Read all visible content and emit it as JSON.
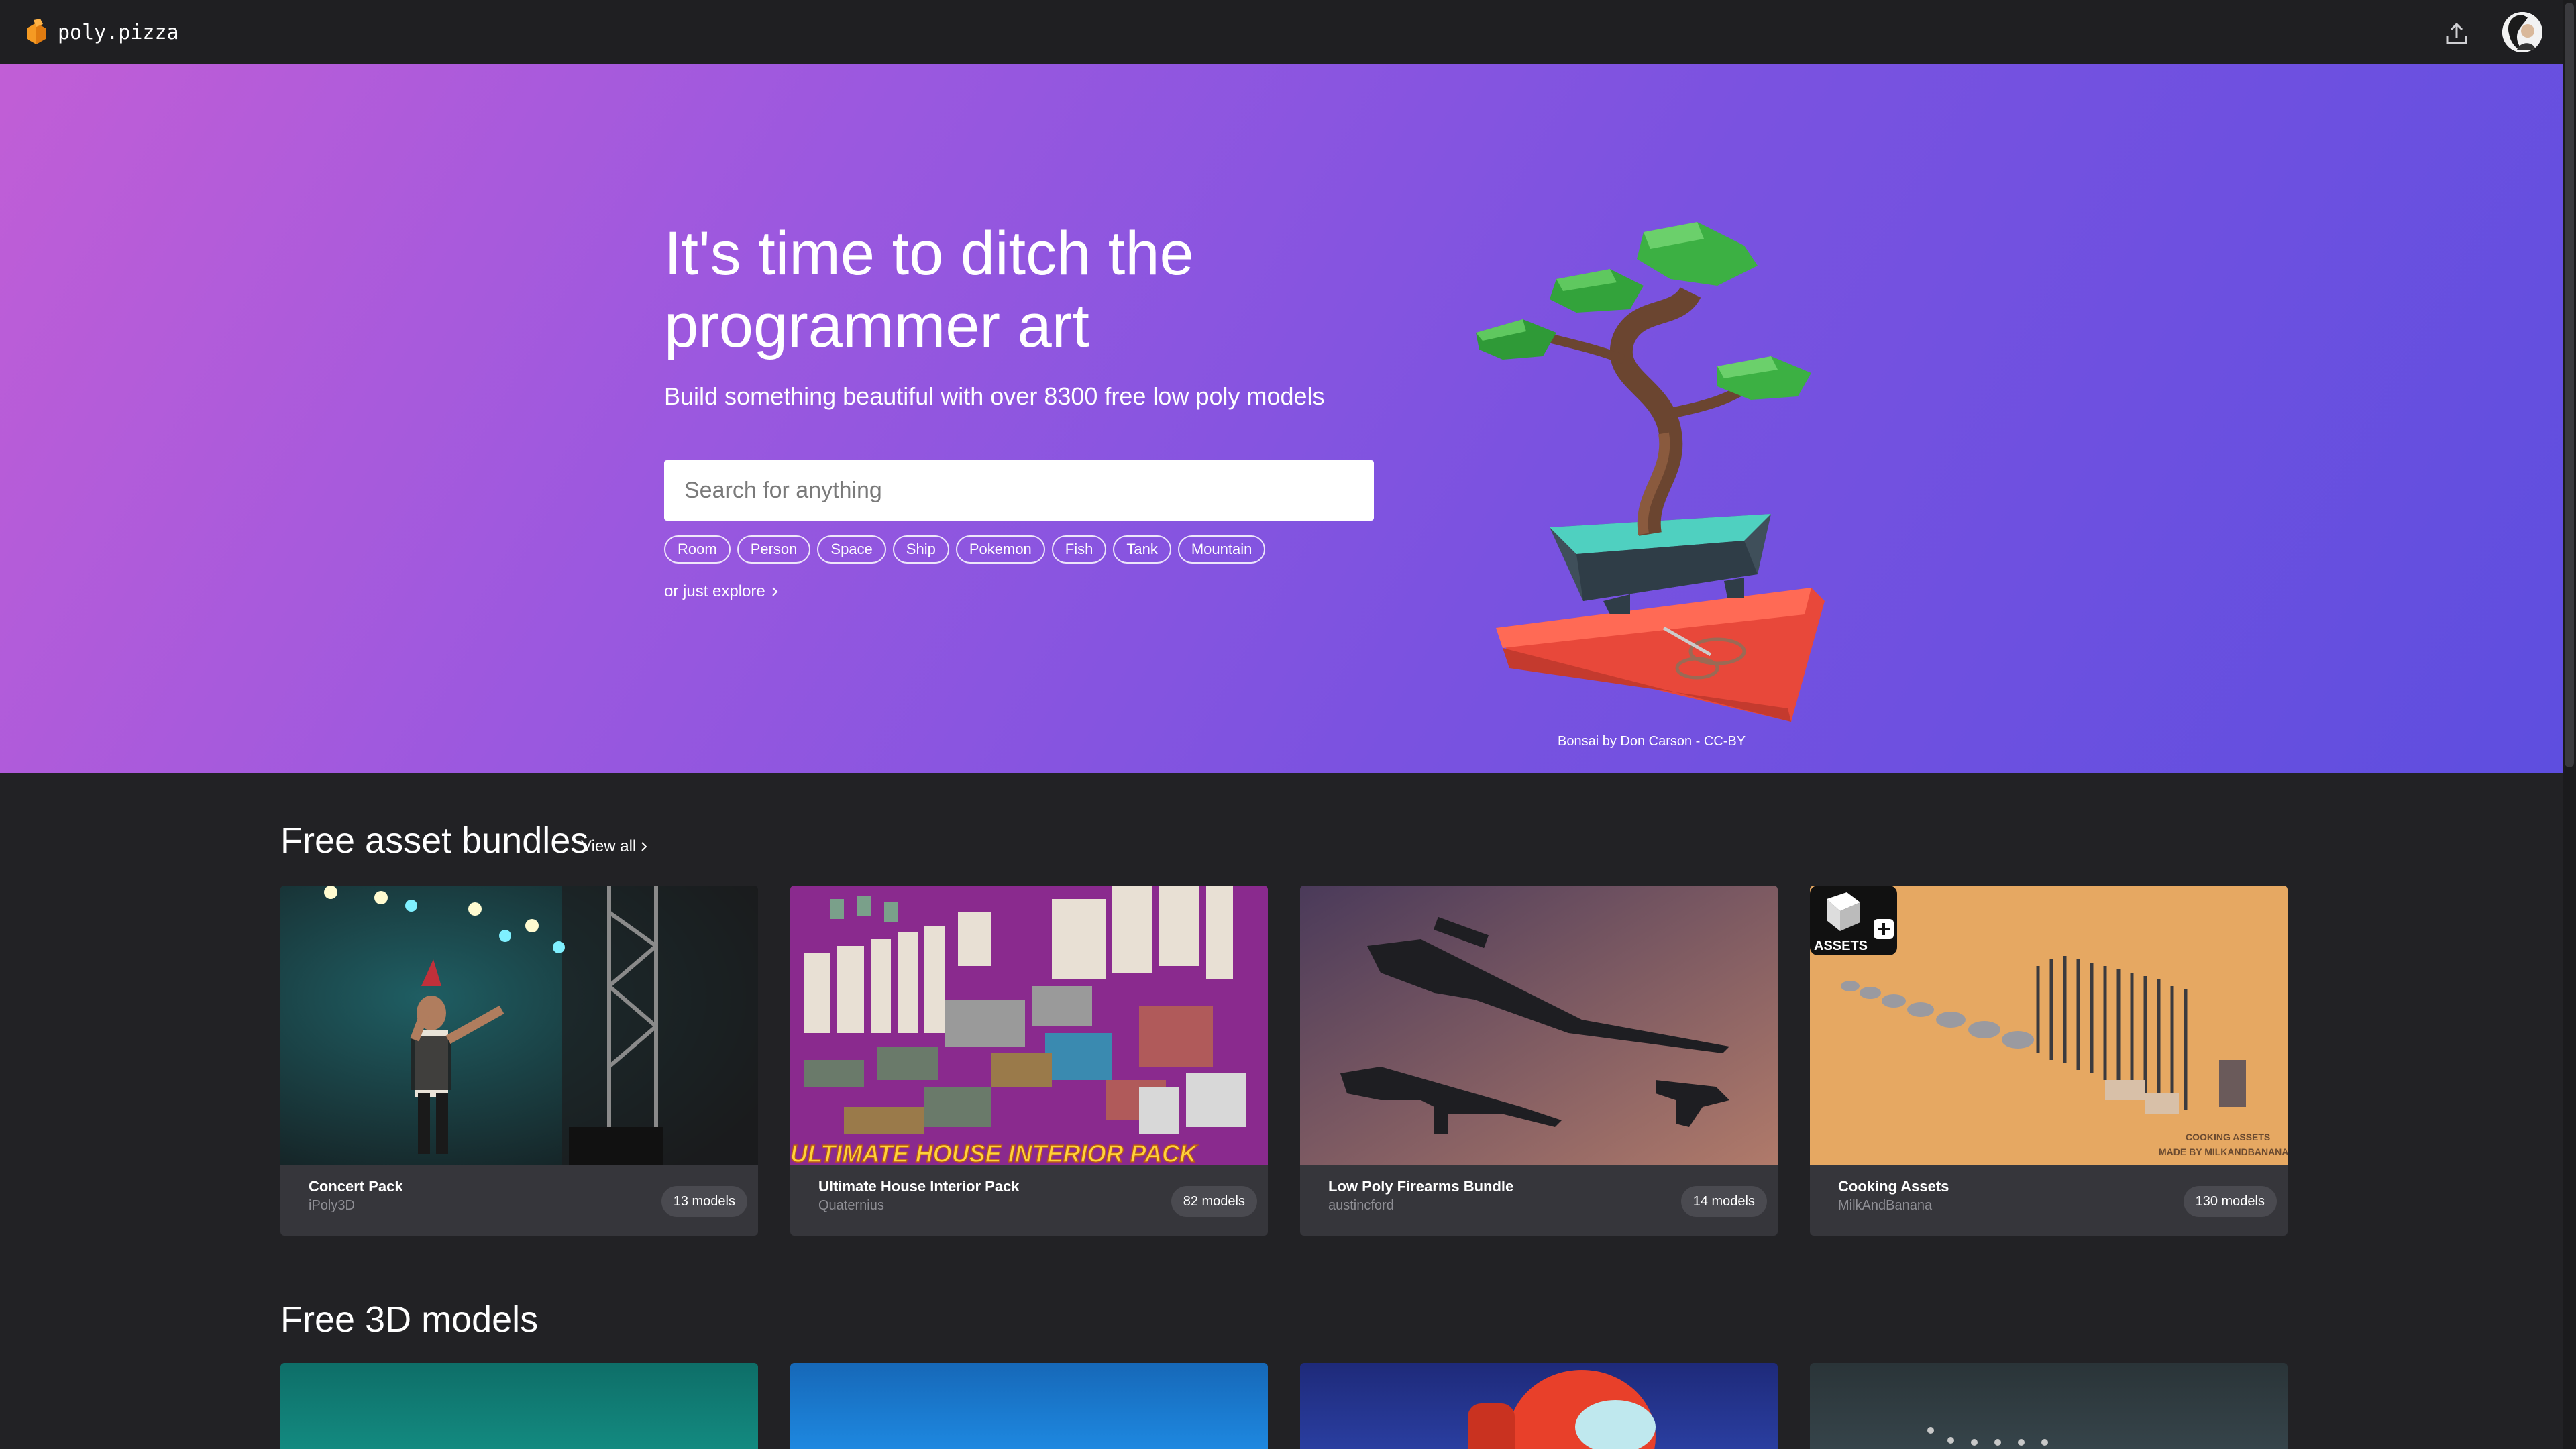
{
  "header": {
    "logo_text": "poly.pizza",
    "upload_icon": "upload-icon",
    "avatar_icon": "user-avatar"
  },
  "hero": {
    "title_line1": "It's time to ditch the",
    "title_line2": "programmer art",
    "subtitle": "Build something beautiful with over 8300 free low poly models",
    "search_placeholder": "Search for anything",
    "tags": [
      "Room",
      "Person",
      "Space",
      "Ship",
      "Pokemon",
      "Fish",
      "Tank",
      "Mountain"
    ],
    "explore_link": "or just explore",
    "credit": "Bonsai by Don Carson - CC-BY",
    "gradient_colors": [
      "#c15ed6",
      "#5e4edf"
    ]
  },
  "bundles": {
    "title": "Free asset bundles",
    "view_all": "View all",
    "items": [
      {
        "title": "Concert Pack",
        "author": "iPoly3D",
        "count": "13 models"
      },
      {
        "title": "Ultimate House Interior Pack",
        "author": "Quaternius",
        "count": "82 models",
        "banner": "ULTIMATE HOUSE INTERIOR PACK"
      },
      {
        "title": "Low Poly Firearms Bundle",
        "author": "austincford",
        "count": "14 models"
      },
      {
        "title": "Cooking Assets",
        "author": "MilkAndBanana",
        "count": "130 models",
        "badge": "ASSETS"
      }
    ]
  },
  "models": {
    "title": "Free 3D models"
  },
  "colors": {
    "background": "#222225",
    "card": "#36363b",
    "topbar": "#1f1f22"
  }
}
